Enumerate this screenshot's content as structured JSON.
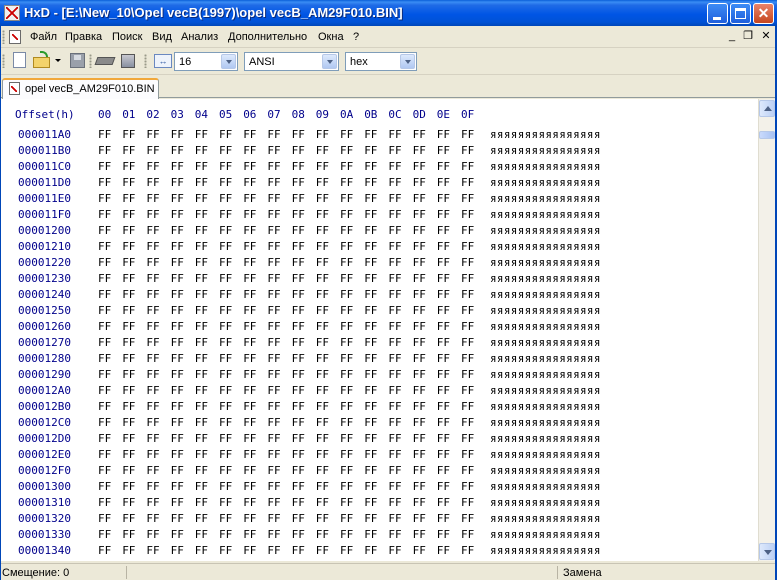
{
  "window": {
    "title": "HxD - [E:\\New_10\\Opel vecB(1997)\\opel vecB_AM29F010.BIN]",
    "minimize_label": "",
    "maximize_label": "",
    "close_label": "✕"
  },
  "menu": {
    "items": [
      "Файл",
      "Правка",
      "Поиск",
      "Вид",
      "Анализ",
      "Дополнительно",
      "Окна",
      "?"
    ],
    "mdi_minimize": "_",
    "mdi_restore": "❐",
    "mdi_close": "✕"
  },
  "toolbar": {
    "bytes_per_row": "16",
    "charset": "ANSI",
    "display_mode": "hex",
    "icons": [
      "new-file-icon",
      "open-folder-icon",
      "save-icon",
      "open-ram-icon",
      "open-disk-icon",
      "columns-icon"
    ]
  },
  "tab": {
    "label": "opel vecB_AM29F010.BIN"
  },
  "editor": {
    "offset_header": "Offset(h)",
    "column_headers": [
      "00",
      "01",
      "02",
      "03",
      "04",
      "05",
      "06",
      "07",
      "08",
      "09",
      "0A",
      "0B",
      "0C",
      "0D",
      "0E",
      "0F"
    ],
    "rows": [
      {
        "offset": "000011A0",
        "ascii": "яяяяяяяяяяяяяяяя"
      },
      {
        "offset": "000011B0",
        "ascii": "яяяяяяяяяяяяяяяя"
      },
      {
        "offset": "000011C0",
        "ascii": "яяяяяяяяяяяяяяяя"
      },
      {
        "offset": "000011D0",
        "ascii": "яяяяяяяяяяяяяяяя"
      },
      {
        "offset": "000011E0",
        "ascii": "яяяяяяяяяяяяяяяя"
      },
      {
        "offset": "000011F0",
        "ascii": "яяяяяяяяяяяяяяяя"
      },
      {
        "offset": "00001200",
        "ascii": "яяяяяяяяяяяяяяяя"
      },
      {
        "offset": "00001210",
        "ascii": "яяяяяяяяяяяяяяяя"
      },
      {
        "offset": "00001220",
        "ascii": "яяяяяяяяяяяяяяяя"
      },
      {
        "offset": "00001230",
        "ascii": "яяяяяяяяяяяяяяяя"
      },
      {
        "offset": "00001240",
        "ascii": "яяяяяяяяяяяяяяяя"
      },
      {
        "offset": "00001250",
        "ascii": "яяяяяяяяяяяяяяяя"
      },
      {
        "offset": "00001260",
        "ascii": "яяяяяяяяяяяяяяяя"
      },
      {
        "offset": "00001270",
        "ascii": "яяяяяяяяяяяяяяяя"
      },
      {
        "offset": "00001280",
        "ascii": "яяяяяяяяяяяяяяяя"
      },
      {
        "offset": "00001290",
        "ascii": "яяяяяяяяяяяяяяяя"
      },
      {
        "offset": "000012A0",
        "ascii": "яяяяяяяяяяяяяяяя"
      },
      {
        "offset": "000012B0",
        "ascii": "яяяяяяяяяяяяяяяя"
      },
      {
        "offset": "000012C0",
        "ascii": "яяяяяяяяяяяяяяяя"
      },
      {
        "offset": "000012D0",
        "ascii": "яяяяяяяяяяяяяяяя"
      },
      {
        "offset": "000012E0",
        "ascii": "яяяяяяяяяяяяяяяя"
      },
      {
        "offset": "000012F0",
        "ascii": "яяяяяяяяяяяяяяяя"
      },
      {
        "offset": "00001300",
        "ascii": "яяяяяяяяяяяяяяяя"
      },
      {
        "offset": "00001310",
        "ascii": "яяяяяяяяяяяяяяяя"
      },
      {
        "offset": "00001320",
        "ascii": "яяяяяяяяяяяяяяяя"
      },
      {
        "offset": "00001330",
        "ascii": "яяяяяяяяяяяяяяяя"
      },
      {
        "offset": "00001340",
        "ascii": "яяяяяяяяяяяяяяяя"
      }
    ],
    "byte_value": "FF"
  },
  "statusbar": {
    "offset_text": "Смещение: 0",
    "mode_text": "Замена"
  },
  "colors": {
    "titlebar": "#0055e5",
    "offset_text": "#00008b",
    "tab_accent": "#f1a83b"
  }
}
